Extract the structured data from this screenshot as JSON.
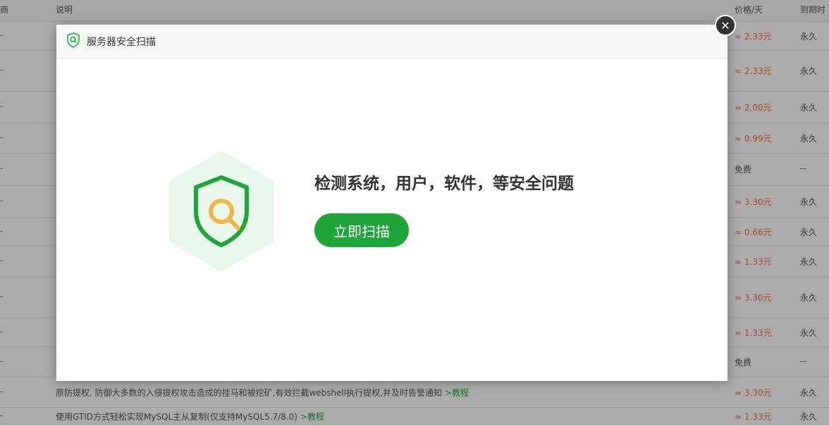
{
  "table": {
    "headers": {
      "col_left": "商",
      "description": "说明",
      "price": "价格/天",
      "expire": "到期时"
    },
    "rows": [
      {
        "desc": "",
        "link": "",
        "price": "≈ 2.33元",
        "expire": "永久"
      },
      {
        "desc": "",
        "link": "",
        "price": "≈ 2.33元",
        "expire": "永久"
      },
      {
        "desc": "",
        "link": "",
        "price": "≈ 2.00元",
        "expire": "永久"
      },
      {
        "desc": "",
        "link": "",
        "price": "≈ 0.99元",
        "expire": "永久"
      },
      {
        "desc": "",
        "link": "",
        "price": "免费",
        "expire": "--"
      },
      {
        "desc": "",
        "link": "",
        "price": "≈ 3.30元",
        "expire": "永久"
      },
      {
        "desc": "",
        "link": "",
        "price": "≈ 0.66元",
        "expire": "永久"
      },
      {
        "desc": "",
        "link": "",
        "price": "≈ 1.33元",
        "expire": "永久"
      },
      {
        "desc": "",
        "link": "",
        "price": "≈ 3.30元",
        "expire": "永久"
      },
      {
        "desc": "",
        "link": "",
        "price": "≈ 1.33元",
        "expire": "永久"
      },
      {
        "desc": "",
        "link": "",
        "price": "免费",
        "expire": "--"
      },
      {
        "desc": "原防提权, 防御大多数的入侵提权攻击造成的挂马和被挖矿,有效拦截webshell执行提权,并及时告警通知",
        "link": ">教程",
        "price": "≈ 3.30元",
        "expire": "永久"
      },
      {
        "desc": "使用GTID方式轻松实现MySQL主从复制(仅支持MySQL5.7/8.0)",
        "link": ">教程",
        "price": "≈ 1.33元",
        "expire": "永久"
      }
    ]
  },
  "modal": {
    "title": "服务器安全扫描",
    "headline": "检测系统，用户，软件，等安全问题",
    "scan_button": "立即扫描",
    "close_label": "✕"
  },
  "colors": {
    "accent": "#20a53a",
    "price": "#ff6b3d",
    "icon_bg": "#e9f6ec",
    "magnifier": "#f0b543"
  }
}
